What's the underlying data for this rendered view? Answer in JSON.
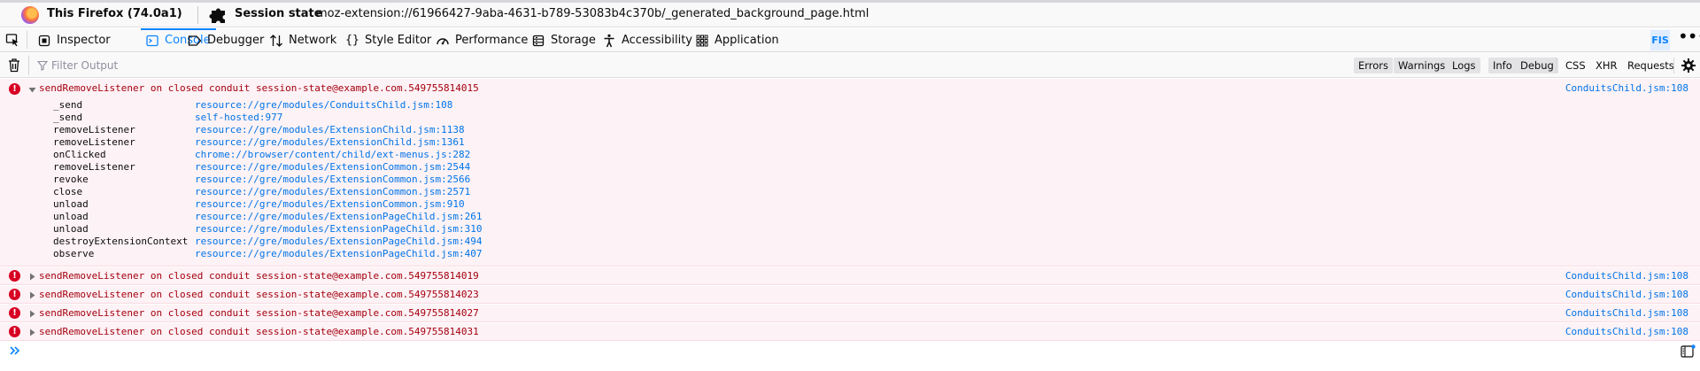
{
  "header": {
    "app_title": "This Firefox (74.0a1)",
    "session_title": "Session state",
    "session_url": "moz-extension://61966427-9aba-4631-b789-53083b4c370b/_generated_background_page.html"
  },
  "toolbar": {
    "tabs": [
      {
        "label": "Inspector",
        "icon": "inspector-icon"
      },
      {
        "label": "Console",
        "icon": "console-icon"
      },
      {
        "label": "Debugger",
        "icon": "debugger-icon"
      },
      {
        "label": "Network",
        "icon": "network-icon"
      },
      {
        "label": "Style Editor",
        "icon": "style-editor-icon"
      },
      {
        "label": "Performance",
        "icon": "performance-icon"
      },
      {
        "label": "Storage",
        "icon": "storage-icon"
      },
      {
        "label": "Accessibility",
        "icon": "accessibility-icon"
      },
      {
        "label": "Application",
        "icon": "application-icon"
      }
    ],
    "active_tab": "Console",
    "badge": "FIS"
  },
  "filterbar": {
    "placeholder": "Filter Output",
    "levels": [
      "Errors",
      "Warnings",
      "Logs",
      "Info",
      "Debug"
    ],
    "requests": [
      "CSS",
      "XHR",
      "Requests"
    ]
  },
  "messages": [
    {
      "text": "sendRemoveListener on closed conduit session-state@example.com.549755814015",
      "location": "ConduitsChild.jsm:108",
      "expanded": true,
      "stack": [
        {
          "fn": "_send",
          "src": "resource://gre/modules/ConduitsChild.jsm:108"
        },
        {
          "fn": "_send",
          "src": "self-hosted:977"
        },
        {
          "fn": "removeListener",
          "src": "resource://gre/modules/ExtensionChild.jsm:1138"
        },
        {
          "fn": "removeListener",
          "src": "resource://gre/modules/ExtensionChild.jsm:1361"
        },
        {
          "fn": "onClicked",
          "src": "chrome://browser/content/child/ext-menus.js:282"
        },
        {
          "fn": "removeListener",
          "src": "resource://gre/modules/ExtensionCommon.jsm:2544"
        },
        {
          "fn": "revoke",
          "src": "resource://gre/modules/ExtensionCommon.jsm:2566"
        },
        {
          "fn": "close",
          "src": "resource://gre/modules/ExtensionCommon.jsm:2571"
        },
        {
          "fn": "unload",
          "src": "resource://gre/modules/ExtensionCommon.jsm:910"
        },
        {
          "fn": "unload",
          "src": "resource://gre/modules/ExtensionPageChild.jsm:261"
        },
        {
          "fn": "unload",
          "src": "resource://gre/modules/ExtensionPageChild.jsm:310"
        },
        {
          "fn": "destroyExtensionContext",
          "src": "resource://gre/modules/ExtensionPageChild.jsm:494"
        },
        {
          "fn": "observe",
          "src": "resource://gre/modules/ExtensionPageChild.jsm:407"
        }
      ]
    },
    {
      "text": "sendRemoveListener on closed conduit session-state@example.com.549755814019",
      "location": "ConduitsChild.jsm:108",
      "expanded": false
    },
    {
      "text": "sendRemoveListener on closed conduit session-state@example.com.549755814023",
      "location": "ConduitsChild.jsm:108",
      "expanded": false
    },
    {
      "text": "sendRemoveListener on closed conduit session-state@example.com.549755814027",
      "location": "ConduitsChild.jsm:108",
      "expanded": false
    },
    {
      "text": "sendRemoveListener on closed conduit session-state@example.com.549755814031",
      "location": "ConduitsChild.jsm:108",
      "expanded": false
    }
  ],
  "colors": {
    "accent": "#0a84ff",
    "error_text": "#a4000f",
    "error_bg": "#fdf2f5",
    "error_icon": "#d70022",
    "link": "#0074e8"
  }
}
